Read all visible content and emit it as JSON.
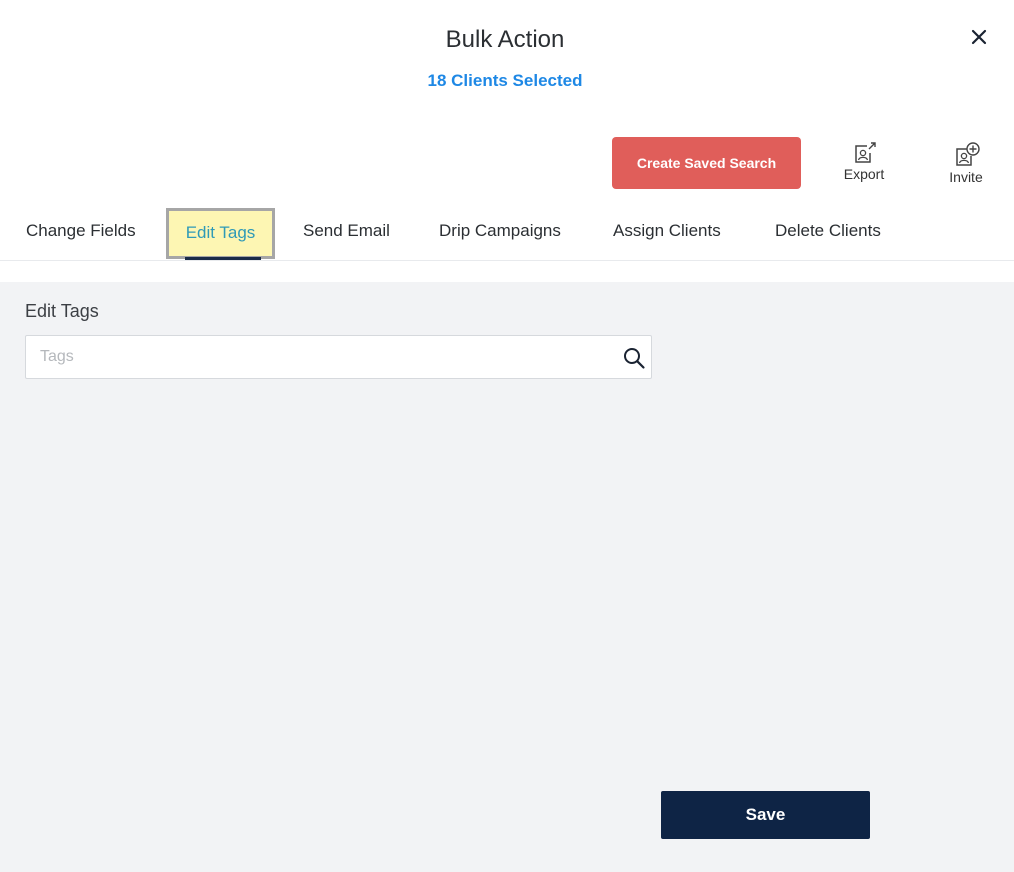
{
  "header": {
    "title": "Bulk Action",
    "subtitle": "18 Clients Selected"
  },
  "actions": {
    "create_saved_search": "Create Saved Search",
    "export_label": "Export",
    "invite_label": "Invite"
  },
  "tabs": [
    {
      "label": "Change Fields"
    },
    {
      "label": "Edit Tags",
      "active": true
    },
    {
      "label": "Send Email"
    },
    {
      "label": "Drip Campaigns"
    },
    {
      "label": "Assign Clients"
    },
    {
      "label": "Delete Clients"
    }
  ],
  "edit_tags": {
    "section_label": "Edit Tags",
    "placeholder": "Tags",
    "value": ""
  },
  "footer": {
    "save_label": "Save"
  },
  "colors": {
    "accent_blue": "#1e88e5",
    "create_button": "#e05e5a",
    "save_button": "#0e2445",
    "active_tab_highlight": "#fdf6b3",
    "content_background": "#f2f3f5"
  },
  "icons": {
    "close": "close-icon",
    "export": "export-icon",
    "invite": "invite-icon",
    "search": "search-icon"
  }
}
